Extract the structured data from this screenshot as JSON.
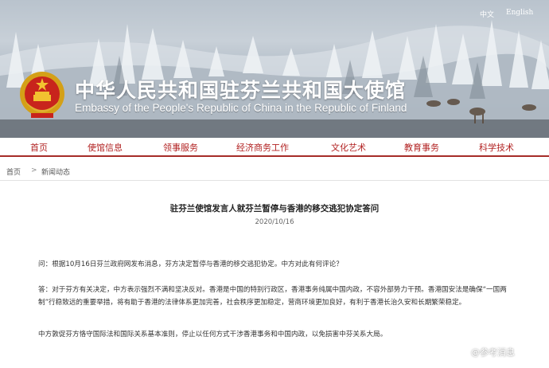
{
  "header": {
    "lang_zh": "中文",
    "lang_en": "English",
    "title_zh": "中华人民共和国驻芬兰共和国大使馆",
    "title_en": "Embassy of the People's Republic of China in the Republic of Finland"
  },
  "nav": {
    "items": [
      "首页",
      "使馆信息",
      "领事服务",
      "经济商务工作",
      "文化艺术",
      "教育事务",
      "科学技术"
    ]
  },
  "breadcrumb": {
    "home": "首页",
    "separator": ">",
    "section": "新闻动态"
  },
  "article": {
    "title": "驻芬兰使馆发言人就芬兰暂停与香港的移交逃犯协定答问",
    "date": "2020/10/16",
    "paragraphs": [
      "问：根据10月16日芬兰政府网发布消息，芬方决定暂停与香港的移交逃犯协定。中方对此有何评论？",
      "答：对于芬方有关决定，中方表示强烈不满和坚决反对。香港是中国的特别行政区，香港事务纯属中国内政，不容外部势力干预。香港国安法是确保“一国两制”行稳致远的重要举措，将有助于香港的法律体系更加完善，社会秩序更加稳定，营商环境更加良好，有利于香港长治久安和长期繁荣稳定。",
      "中方敦促芬方恪守国际法和国际关系基本准则，停止以任何方式干涉香港事务和中国内政，以免损害中芬关系大局。"
    ]
  },
  "watermark": "@参考消息",
  "colors": {
    "nav_text": "#b22222",
    "nav_rule": "#a62c28",
    "banner_sky": "#c8d0d8"
  }
}
